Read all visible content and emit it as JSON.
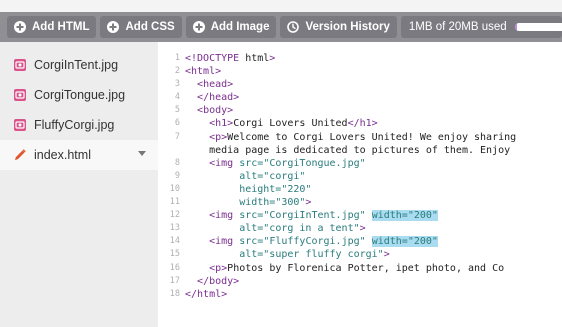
{
  "toolbar": {
    "buttons": [
      {
        "label": "Add HTML",
        "icon": "plus-circle-icon"
      },
      {
        "label": "Add CSS",
        "icon": "plus-circle-icon"
      },
      {
        "label": "Add Image",
        "icon": "plus-circle-icon"
      },
      {
        "label": "Version History",
        "icon": "clock-icon"
      }
    ],
    "usage_text": "1MB of 20MB used",
    "usage_fraction": 0.05
  },
  "files": [
    {
      "name": "CorgiInTent.jpg",
      "type": "image"
    },
    {
      "name": "CorgiTongue.jpg",
      "type": "image"
    },
    {
      "name": "FluffyCorgi.jpg",
      "type": "image"
    },
    {
      "name": "index.html",
      "type": "html",
      "selected": true
    }
  ],
  "colors": {
    "toolbar": "#8f8f94",
    "image_icon": "#d8548a",
    "html_icon": "#e0552b",
    "highlight": "#a9dcf0",
    "meter": "#b78ad8"
  },
  "editor": {
    "line_numbers": [
      "1",
      "2",
      "3",
      "4",
      "5",
      "6",
      "7",
      "",
      "8",
      "9",
      "10",
      "11",
      "12",
      "13",
      "14",
      "15",
      "16",
      "17",
      "18"
    ],
    "lines": [
      "<!DOCTYPE html>",
      "<html>",
      "  <head>",
      "  </head>",
      "  <body>",
      "    <h1>Corgi Lovers United</h1>",
      "    <p>Welcome to Corgi Lovers United! We enjoy sharing",
      "    media page is dedicated to pictures of them. Enjoy",
      "    <img src=\"CorgiTongue.jpg\"",
      "         alt=\"corgi\"",
      "         height=\"220\"",
      "         width=\"300\">",
      "    <img src=\"CorgiInTent.jpg\" width=\"200\"",
      "         alt=\"corg in a tent\">",
      "    <img src=\"FluffyCorgi.jpg\" width=\"200\"",
      "         alt=\"super fluffy corgi\">",
      "    <p>Photos by Florenica Potter, ipet photo, and Co",
      "  </body>",
      "</html>"
    ]
  }
}
